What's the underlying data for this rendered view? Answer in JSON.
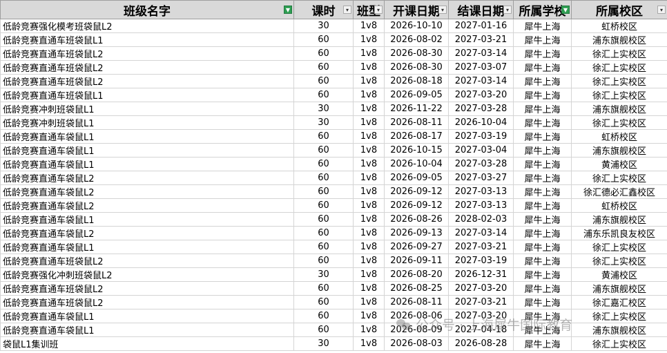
{
  "headers": [
    "班级名字",
    "课时",
    "班型",
    "开课日期",
    "结课日期",
    "所属学校",
    "所属校区"
  ],
  "filter_icons": [
    "filter-active-icon",
    "dropdown-icon",
    "dropdown-icon",
    "dropdown-icon",
    "dropdown-icon",
    "filter-active-icon",
    "dropdown-icon"
  ],
  "rows": [
    [
      "低龄竞赛强化模考班袋鼠L2",
      "30",
      "1v8",
      "2026-10-10",
      "2027-01-16",
      "犀牛上海",
      "虹桥校区"
    ],
    [
      "低龄竞赛直通车班袋鼠L1",
      "60",
      "1v8",
      "2026-08-02",
      "2027-03-21",
      "犀牛上海",
      "浦东旗舰校区"
    ],
    [
      "低龄竞赛直通车班袋鼠L2",
      "60",
      "1v8",
      "2026-08-30",
      "2027-03-14",
      "犀牛上海",
      "徐汇上实校区"
    ],
    [
      "低龄竞赛直通车班袋鼠L2",
      "60",
      "1v8",
      "2026-08-30",
      "2027-03-07",
      "犀牛上海",
      "徐汇上实校区"
    ],
    [
      "低龄竞赛直通车班袋鼠L2",
      "60",
      "1v8",
      "2026-08-18",
      "2027-03-14",
      "犀牛上海",
      "徐汇上实校区"
    ],
    [
      "低龄竞赛直通车班袋鼠L1",
      "60",
      "1v8",
      "2026-09-05",
      "2027-03-20",
      "犀牛上海",
      "徐汇上实校区"
    ],
    [
      "低龄竞赛冲刺班袋鼠L1",
      "30",
      "1v8",
      "2026-11-22",
      "2027-03-28",
      "犀牛上海",
      "浦东旗舰校区"
    ],
    [
      "低龄竞赛冲刺班袋鼠L1",
      "30",
      "1v8",
      "2026-08-11",
      "2026-10-04",
      "犀牛上海",
      "徐汇上实校区"
    ],
    [
      "低龄竞赛直通车袋鼠L1",
      "60",
      "1v8",
      "2026-08-17",
      "2027-03-19",
      "犀牛上海",
      "虹桥校区"
    ],
    [
      "低龄竞赛直通车袋鼠L1",
      "60",
      "1v8",
      "2026-10-15",
      "2027-03-04",
      "犀牛上海",
      "浦东旗舰校区"
    ],
    [
      "低龄竞赛直通车袋鼠L1",
      "60",
      "1v8",
      "2026-10-04",
      "2027-03-28",
      "犀牛上海",
      "黄浦校区"
    ],
    [
      "低龄竞赛直通车袋鼠L2",
      "60",
      "1v8",
      "2026-09-05",
      "2027-03-27",
      "犀牛上海",
      "徐汇上实校区"
    ],
    [
      "低龄竞赛直通车袋鼠L2",
      "60",
      "1v8",
      "2026-09-12",
      "2027-03-13",
      "犀牛上海",
      "徐汇德必汇鑫校区"
    ],
    [
      "低龄竞赛直通车袋鼠L2",
      "60",
      "1v8",
      "2026-09-12",
      "2027-03-13",
      "犀牛上海",
      "虹桥校区"
    ],
    [
      "低龄竞赛直通车袋鼠L1",
      "60",
      "1v8",
      "2026-08-26",
      "2028-02-03",
      "犀牛上海",
      "浦东旗舰校区"
    ],
    [
      "低龄竞赛直通车袋鼠L2",
      "60",
      "1v8",
      "2026-09-13",
      "2027-03-14",
      "犀牛上海",
      "浦东乐凯良友校区"
    ],
    [
      "低龄竞赛直通车袋鼠L1",
      "60",
      "1v8",
      "2026-09-27",
      "2027-03-21",
      "犀牛上海",
      "徐汇上实校区"
    ],
    [
      "低龄竞赛直通车班袋鼠L2",
      "60",
      "1v8",
      "2026-09-11",
      "2027-03-19",
      "犀牛上海",
      "徐汇上实校区"
    ],
    [
      "低龄竞赛强化冲刺班袋鼠L2",
      "30",
      "1v8",
      "2026-08-20",
      "2026-12-31",
      "犀牛上海",
      "黄浦校区"
    ],
    [
      "低龄竞赛直通车班袋鼠L2",
      "60",
      "1v8",
      "2026-08-25",
      "2027-03-20",
      "犀牛上海",
      "浦东旗舰校区"
    ],
    [
      "低龄竞赛直通车班袋鼠L2",
      "60",
      "1v8",
      "2026-08-11",
      "2027-03-21",
      "犀牛上海",
      "徐汇嘉汇校区"
    ],
    [
      "低龄竞赛直通车袋鼠L1",
      "60",
      "1v8",
      "2026-08-06",
      "2027-03-20",
      "犀牛上海",
      "徐汇上实校区"
    ],
    [
      "低龄竞赛直通车袋鼠L1",
      "60",
      "1v8",
      "2026-08-09",
      "2027-04-18",
      "犀牛上海",
      "浦东旗舰校区"
    ],
    [
      "袋鼠L1集训班",
      "30",
      "1v8",
      "2026-08-03",
      "2026-08-28",
      "犀牛上海",
      "徐汇上实校区"
    ]
  ],
  "watermark": "公众号 · 上海犀牛国际教育",
  "colors": {
    "header_bg": "#d9d9d9",
    "filter_active": "#2e9e52",
    "grid": "#d4d4d4"
  }
}
